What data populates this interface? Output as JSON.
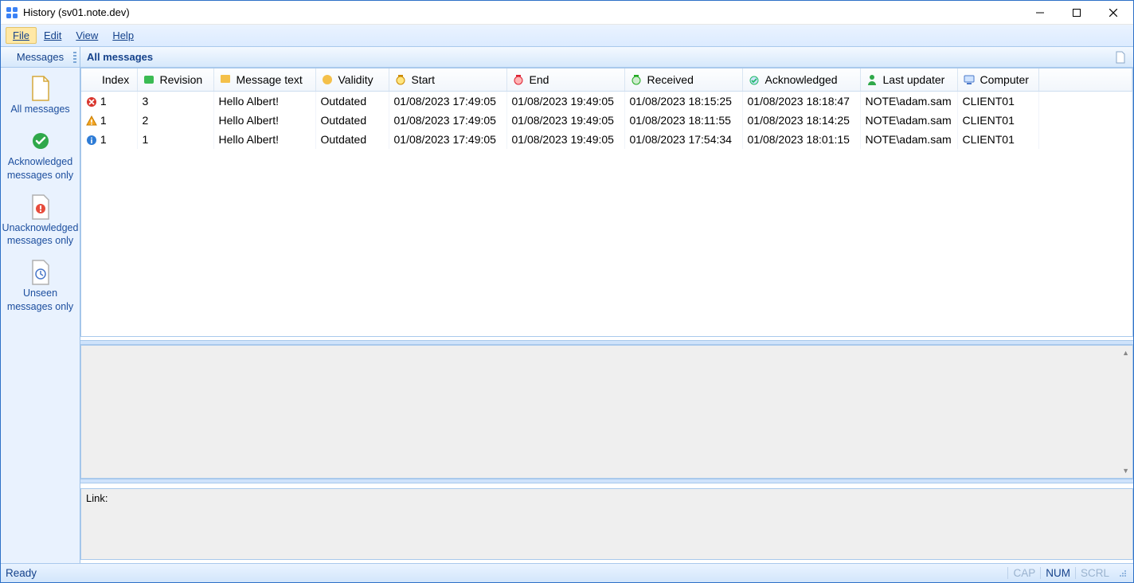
{
  "window": {
    "title": "History (sv01.note.dev)"
  },
  "menu": {
    "file": "File",
    "edit": "Edit",
    "view": "View",
    "help": "Help"
  },
  "side_header": "Messages",
  "sidebar": {
    "items": [
      {
        "label": "All messages"
      },
      {
        "label": "Acknowledged messages only"
      },
      {
        "label": "Unacknowledged messages only"
      },
      {
        "label": "Unseen messages only"
      }
    ]
  },
  "content_header": "All messages",
  "columns": {
    "index": "Index",
    "revision": "Revision",
    "message": "Message text",
    "validity": "Validity",
    "start": "Start",
    "end": "End",
    "received": "Received",
    "acknowledged": "Acknowledged",
    "updater": "Last updater",
    "computer": "Computer"
  },
  "rows": [
    {
      "icon": "error",
      "index": "1",
      "revision": "3",
      "message": "Hello Albert!",
      "validity": "Outdated",
      "start": "01/08/2023 17:49:05",
      "end": "01/08/2023 19:49:05",
      "received": "01/08/2023 18:15:25",
      "acknowledged": "01/08/2023 18:18:47",
      "updater": "NOTE\\adam.sam",
      "computer": "CLIENT01"
    },
    {
      "icon": "warning",
      "index": "1",
      "revision": "2",
      "message": "Hello Albert!",
      "validity": "Outdated",
      "start": "01/08/2023 17:49:05",
      "end": "01/08/2023 19:49:05",
      "received": "01/08/2023 18:11:55",
      "acknowledged": "01/08/2023 18:14:25",
      "updater": "NOTE\\adam.sam",
      "computer": "CLIENT01"
    },
    {
      "icon": "info",
      "index": "1",
      "revision": "1",
      "message": "Hello Albert!",
      "validity": "Outdated",
      "start": "01/08/2023 17:49:05",
      "end": "01/08/2023 19:49:05",
      "received": "01/08/2023 17:54:34",
      "acknowledged": "01/08/2023 18:01:15",
      "updater": "NOTE\\adam.sam",
      "computer": "CLIENT01"
    }
  ],
  "link_label": "Link:",
  "status": {
    "ready": "Ready",
    "cap": "CAP",
    "num": "NUM",
    "scrl": "SCRL"
  }
}
